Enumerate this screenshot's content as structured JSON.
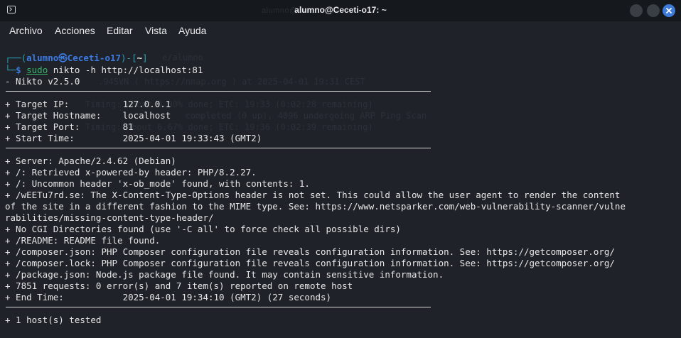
{
  "window": {
    "title": "alumno@Ceceti-o17: ~",
    "ghost_title": "alumno@Ceceti-o17: ~"
  },
  "menu": [
    "Archivo",
    "Acciones",
    "Editar",
    "Vista",
    "Ayuda"
  ],
  "prompt": {
    "prefix_top": "┌──(",
    "user_host": "alumno㉿Ceceti-o17",
    "middle": ")-[",
    "dir": "~",
    "suffix_top": "]",
    "prefix_bottom": "└─",
    "dollar": "$ ",
    "sudo": "sudo",
    "command": " nikto -h http://localhost:81"
  },
  "ghost_lines": [
    "e/alumno",
    ".94SVN ( https://nmap.org ) at 2025-04-01 19:31 CEST",
    "Timing: About 0.00% done; ETC: 19:33 (0:02:28 remaining)",
    "       completed (0 up), 4096 undergoing ARP Ping Scan",
    "Timing: About 6.67% done; ETC: 19:36 (0:02:39 remaining)"
  ],
  "output": {
    "version": "- Nikto v2.5.0",
    "target_lines": [
      "+ Target IP:          127.0.0.1",
      "+ Target Hostname:    localhost",
      "+ Target Port:        81",
      "+ Start Time:         2025-04-01 19:33:43 (GMT2)"
    ],
    "result_lines": [
      "+ Server: Apache/2.4.62 (Debian)",
      "+ /: Retrieved x-powered-by header: PHP/8.2.27.",
      "+ /: Uncommon header 'x-ob_mode' found, with contents: 1.",
      "+ /wEETu7rd.se: The X-Content-Type-Options header is not set. This could allow the user agent to render the content",
      "of the site in a different fashion to the MIME type. See: https://www.netsparker.com/web-vulnerability-scanner/vulne",
      "rabilities/missing-content-type-header/",
      "+ No CGI Directories found (use '-C all' to force check all possible dirs)",
      "+ /README: README file found.",
      "+ /composer.json: PHP Composer configuration file reveals configuration information. See: https://getcomposer.org/",
      "+ /composer.lock: PHP Composer configuration file reveals configuration information. See: https://getcomposer.org/",
      "+ /package.json: Node.js package file found. It may contain sensitive information.",
      "+ 7851 requests: 0 error(s) and 7 item(s) reported on remote host",
      "+ End Time:           2025-04-01 19:34:10 (GMT2) (27 seconds)"
    ],
    "summary": "+ 1 host(s) tested"
  }
}
